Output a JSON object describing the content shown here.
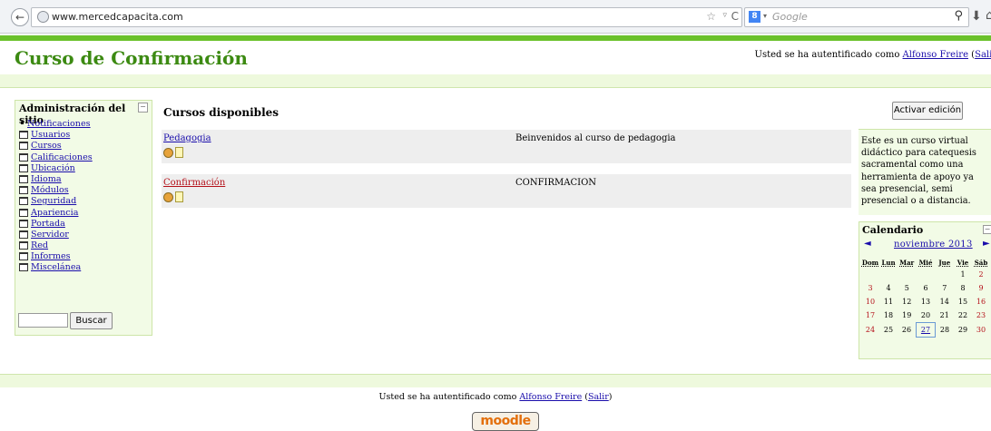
{
  "browser": {
    "url": "www.mercedcapacita.com",
    "search_placeholder": "Google",
    "back_glyph": "←",
    "star_glyph": "☆",
    "drop_glyph": "▿",
    "reload_glyph": "C",
    "search_drop_glyph": "▾",
    "mag_glyph": "⚲",
    "download_glyph": "⬇",
    "home_glyph": "⌂",
    "google_glyph": "8"
  },
  "header": {
    "site_title": "Curso de Confirmación",
    "login_prefix": "Usted se ha autentificado como ",
    "user_name": "Alfonso Freire",
    "logout_open": " (",
    "logout_label": "Salir",
    "logout_close": ")"
  },
  "admin": {
    "title": "Administración del sitio",
    "toggle": "−",
    "items": [
      {
        "label": "Notificaciones"
      },
      {
        "label": "Usuarios"
      },
      {
        "label": "Cursos"
      },
      {
        "label": "Calificaciones"
      },
      {
        "label": "Ubicación"
      },
      {
        "label": "Idioma"
      },
      {
        "label": "Módulos"
      },
      {
        "label": "Seguridad"
      },
      {
        "label": "Apariencia"
      },
      {
        "label": "Portada"
      },
      {
        "label": "Servidor"
      },
      {
        "label": "Red"
      },
      {
        "label": "Informes"
      },
      {
        "label": "Miscelánea"
      }
    ],
    "search_button": "Buscar"
  },
  "main": {
    "heading": "Cursos disponibles",
    "courses": [
      {
        "name": "Pedagogia",
        "summary": "Beinvenidos al curso de pedagogia"
      },
      {
        "name": "Confirmación",
        "summary": "CONFIRMACION"
      }
    ]
  },
  "right": {
    "edit_button": "Activar edición",
    "description": "Este es un curso virtual didáctico para catequesis sacramental como una herramienta de apoyo ya sea presencial, semi presencial o a distancia.",
    "calendar": {
      "title": "Calendario",
      "toggle": "−",
      "prev": "◄",
      "next": "►",
      "month": "noviembre 2013",
      "weekdays": [
        "Dom",
        "Lun",
        "Mar",
        "Mié",
        "Jue",
        "Vie",
        "Sáb"
      ],
      "weeks": [
        [
          "",
          "",
          "",
          "",
          "",
          "1",
          "2"
        ],
        [
          "3",
          "4",
          "5",
          "6",
          "7",
          "8",
          "9"
        ],
        [
          "10",
          "11",
          "12",
          "13",
          "14",
          "15",
          "16"
        ],
        [
          "17",
          "18",
          "19",
          "20",
          "21",
          "22",
          "23"
        ],
        [
          "24",
          "25",
          "26",
          "27",
          "28",
          "29",
          "30"
        ]
      ],
      "today": "27"
    }
  },
  "footer": {
    "login_prefix": "Usted se ha autentificado como ",
    "user_name": "Alfonso Freire",
    "logout_open": " (",
    "logout_label": "Salir",
    "logout_close": ")",
    "logo_text": "moodle"
  },
  "colors": {
    "brand_green": "#6bc12b",
    "title_green": "#3c8a12",
    "block_bg": "#f2fbe6",
    "weekend_red": "#b5121b",
    "link_blue": "#1a0dab"
  }
}
